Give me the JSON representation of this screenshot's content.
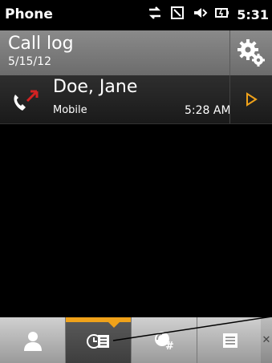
{
  "statusbar": {
    "app_title": "Phone",
    "time": "5:31"
  },
  "header": {
    "title": "Call log",
    "date": "5/15/12"
  },
  "call_log": [
    {
      "name": "Doe, Jane",
      "type": "Mobile",
      "time": "5:28 AM"
    }
  ],
  "tabs": [
    {
      "icon": "contacts-icon"
    },
    {
      "icon": "call-log-icon"
    },
    {
      "icon": "dialpad-icon"
    },
    {
      "icon": "menu-icon"
    }
  ],
  "colors": {
    "accent": "#f0a21a",
    "missed_call": "#d22222"
  }
}
